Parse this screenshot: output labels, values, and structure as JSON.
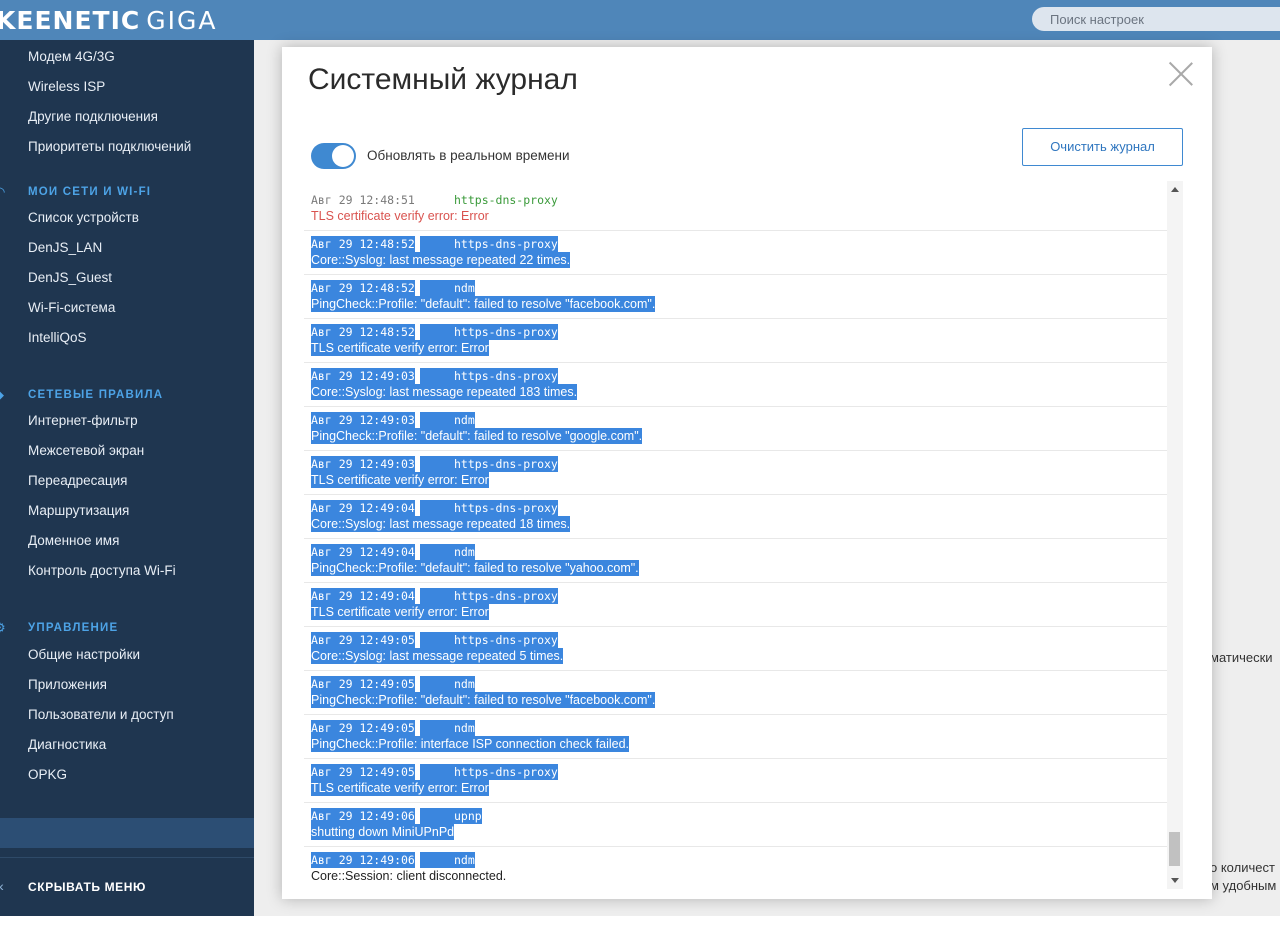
{
  "header": {
    "brand": "KEENETIC",
    "model": "GIGA",
    "search_placeholder": "Поиск настроек"
  },
  "sidebar": {
    "items_top": [
      "Модем 4G/3G",
      "Wireless ISP",
      "Другие подключения",
      "Приоритеты подключений"
    ],
    "section_networks": "МОИ СЕТИ И WI-FI",
    "items_networks": [
      "Список устройств",
      "DenJS_LAN",
      "DenJS_Guest",
      "Wi-Fi-система",
      "IntelliQoS"
    ],
    "section_rules": "СЕТЕВЫЕ ПРАВИЛА",
    "items_rules": [
      "Интернет-фильтр",
      "Межсетевой экран",
      "Переадресация",
      "Маршрутизация",
      "Доменное имя",
      "Контроль доступа Wi-Fi"
    ],
    "section_management": "УПРАВЛЕНИЕ",
    "items_management": [
      "Общие настройки",
      "Приложения",
      "Пользователи и доступ",
      "Диагностика",
      "OPKG"
    ],
    "active_item": "Диагностика",
    "hide_menu": "СКРЫВАТЬ МЕНЮ"
  },
  "background": {
    "fragment_1": "матически",
    "fragment_2": "о количест",
    "fragment_3": "м удобным"
  },
  "modal": {
    "title": "Системный журнал",
    "realtime_label": "Обновлять в реальном времени",
    "realtime_on": true,
    "clear_button": "Очистить журнал"
  },
  "log": [
    {
      "ts": "Авг 29 12:48:51",
      "src": "https-dns-proxy",
      "msg": "TLS certificate verify error: Error",
      "error": true,
      "selected": false
    },
    {
      "ts": "Авг 29 12:48:52",
      "src": "https-dns-proxy",
      "msg": "Core::Syslog: last message repeated 22 times.",
      "error": false,
      "selected": true
    },
    {
      "ts": "Авг 29 12:48:52",
      "src": "ndm",
      "msg": "PingCheck::Profile: \"default\": failed to resolve \"facebook.com\".",
      "error": false,
      "selected": true
    },
    {
      "ts": "Авг 29 12:48:52",
      "src": "https-dns-proxy",
      "msg": "TLS certificate verify error: Error",
      "error": true,
      "selected": true
    },
    {
      "ts": "Авг 29 12:49:03",
      "src": "https-dns-proxy",
      "msg": "Core::Syslog: last message repeated 183 times.",
      "error": false,
      "selected": true
    },
    {
      "ts": "Авг 29 12:49:03",
      "src": "ndm",
      "msg": "PingCheck::Profile: \"default\": failed to resolve \"google.com\".",
      "error": false,
      "selected": true
    },
    {
      "ts": "Авг 29 12:49:03",
      "src": "https-dns-proxy",
      "msg": "TLS certificate verify error: Error",
      "error": true,
      "selected": true
    },
    {
      "ts": "Авг 29 12:49:04",
      "src": "https-dns-proxy",
      "msg": "Core::Syslog: last message repeated 18 times.",
      "error": false,
      "selected": true
    },
    {
      "ts": "Авг 29 12:49:04",
      "src": "ndm",
      "msg": "PingCheck::Profile: \"default\": failed to resolve \"yahoo.com\".",
      "error": false,
      "selected": true
    },
    {
      "ts": "Авг 29 12:49:04",
      "src": "https-dns-proxy",
      "msg": "TLS certificate verify error: Error",
      "error": true,
      "selected": true
    },
    {
      "ts": "Авг 29 12:49:05",
      "src": "https-dns-proxy",
      "msg": "Core::Syslog: last message repeated 5 times.",
      "error": false,
      "selected": true
    },
    {
      "ts": "Авг 29 12:49:05",
      "src": "ndm",
      "msg": "PingCheck::Profile: \"default\": failed to resolve \"facebook.com\".",
      "error": false,
      "selected": true
    },
    {
      "ts": "Авг 29 12:49:05",
      "src": "ndm",
      "msg": "PingCheck::Profile: interface ISP connection check failed.",
      "error": false,
      "selected": true
    },
    {
      "ts": "Авг 29 12:49:05",
      "src": "https-dns-proxy",
      "msg": "TLS certificate verify error: Error",
      "error": true,
      "selected": true
    },
    {
      "ts": "Авг 29 12:49:06",
      "src": "upnp",
      "msg": "shutting down MiniUPnPd",
      "error": false,
      "selected": true
    },
    {
      "ts": "Авг 29 12:49:06",
      "src": "ndm",
      "msg": "Core::Session: client disconnected.",
      "error": false,
      "selected": "partial"
    }
  ],
  "colors": {
    "topbar": "#4f86b9",
    "sidebar": "#1f3650",
    "accent": "#3f89d1",
    "selection": "#3b86de",
    "error_text": "#d9534f",
    "source_text": "#3a9a3a"
  }
}
